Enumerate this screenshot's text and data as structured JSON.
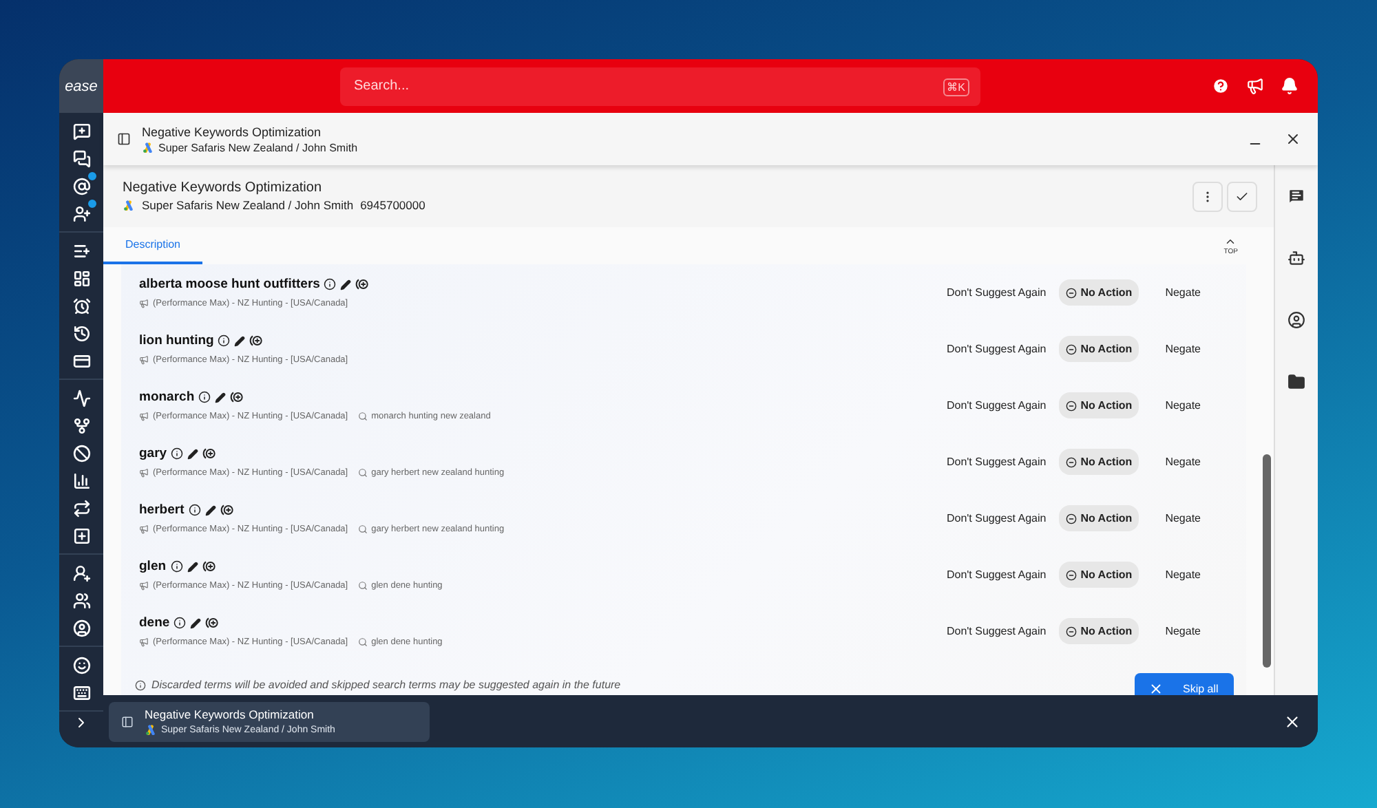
{
  "sidebar": {
    "logo": "ease",
    "groups": [
      [
        {
          "badge": false
        },
        {
          "badge": false
        },
        {
          "badge": true
        },
        {
          "badge": true
        }
      ],
      [
        {
          "badge": false
        },
        {
          "badge": false
        },
        {
          "badge": false
        },
        {
          "badge": false
        },
        {
          "badge": false
        }
      ],
      [
        {
          "badge": false
        },
        {
          "badge": false
        },
        {
          "badge": false
        },
        {
          "badge": false
        },
        {
          "badge": false
        },
        {
          "badge": false
        }
      ],
      [
        {
          "badge": false
        },
        {
          "badge": false
        },
        {
          "badge": false
        }
      ],
      [
        {
          "badge": false
        },
        {
          "badge": false
        }
      ]
    ]
  },
  "topbar": {
    "search": {
      "placeholder": "Search...",
      "shortcut": "⌘K"
    }
  },
  "panel": {
    "title": "Negative Keywords Optimization",
    "subtitle": "Super Safaris New Zealand / John Smith"
  },
  "task": {
    "title": "Negative Keywords Optimization",
    "account": "Super Safaris New Zealand / John Smith",
    "account_id": "6945700000"
  },
  "tabs": [
    {
      "label": "Description",
      "selected": true
    }
  ],
  "top_label": "TOP",
  "rows": [
    {
      "keyword": "alberta moose hunt outfitters",
      "campaign": "(Performance Max) - NZ Hunting - [USA/Canada]",
      "actions": [
        {
          "label": "Don't Suggest Again",
          "selected": false
        },
        {
          "label": "No Action",
          "selected": true
        },
        {
          "label": "Negate",
          "selected": false
        }
      ]
    },
    {
      "keyword": "lion hunting",
      "campaign": "(Performance Max) - NZ Hunting - [USA/Canada]",
      "actions": [
        {
          "label": "Don't Suggest Again",
          "selected": false
        },
        {
          "label": "No Action",
          "selected": true
        },
        {
          "label": "Negate",
          "selected": false
        }
      ]
    },
    {
      "keyword": "monarch",
      "campaign": "(Performance Max) - NZ Hunting - [USA/Canada]",
      "search_term": "monarch hunting new zealand",
      "actions": [
        {
          "label": "Don't Suggest Again",
          "selected": false
        },
        {
          "label": "No Action",
          "selected": true
        },
        {
          "label": "Negate",
          "selected": false
        }
      ]
    },
    {
      "keyword": "gary",
      "campaign": "(Performance Max) - NZ Hunting - [USA/Canada]",
      "search_term": "gary herbert new zealand hunting",
      "actions": [
        {
          "label": "Don't Suggest Again",
          "selected": false
        },
        {
          "label": "No Action",
          "selected": true
        },
        {
          "label": "Negate",
          "selected": false
        }
      ]
    },
    {
      "keyword": "herbert",
      "campaign": "(Performance Max) - NZ Hunting - [USA/Canada]",
      "search_term": "gary herbert new zealand hunting",
      "actions": [
        {
          "label": "Don't Suggest Again",
          "selected": false
        },
        {
          "label": "No Action",
          "selected": true
        },
        {
          "label": "Negate",
          "selected": false
        }
      ]
    },
    {
      "keyword": "glen",
      "campaign": "(Performance Max) - NZ Hunting - [USA/Canada]",
      "search_term": "glen dene hunting",
      "actions": [
        {
          "label": "Don't Suggest Again",
          "selected": false
        },
        {
          "label": "No Action",
          "selected": true
        },
        {
          "label": "Negate",
          "selected": false
        }
      ]
    },
    {
      "keyword": "dene",
      "campaign": "(Performance Max) - NZ Hunting - [USA/Canada]",
      "search_term": "glen dene hunting",
      "actions": [
        {
          "label": "Don't Suggest Again",
          "selected": false
        },
        {
          "label": "No Action",
          "selected": true
        },
        {
          "label": "Negate",
          "selected": false
        }
      ]
    }
  ],
  "note": "Discarded terms will be avoided and skipped search terms may be suggested again in the future",
  "skip_button": "Skip all",
  "taskbar": {
    "title": "Negative Keywords Optimization",
    "subtitle": "Super Safaris New Zealand / John Smith"
  }
}
